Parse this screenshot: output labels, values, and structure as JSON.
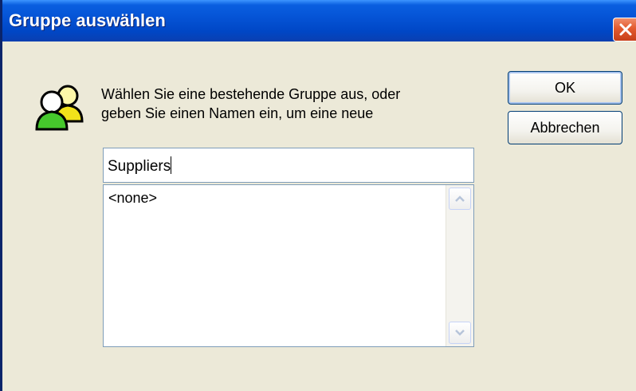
{
  "window": {
    "title": "Gruppe auswählen",
    "close_icon": "close-icon"
  },
  "dialog": {
    "icon": "user-group-icon",
    "instruction_line1": "Wählen Sie eine bestehende Gruppe aus, oder",
    "instruction_line2": "geben Sie einen Namen ein, um eine neue"
  },
  "buttons": {
    "ok_label": "OK",
    "cancel_label": "Abbrechen"
  },
  "name_input": {
    "value": "Suppliers"
  },
  "group_list": {
    "items": [
      "<none>"
    ]
  },
  "colors": {
    "title_bar": "#0554d6",
    "close_button": "#e35a2e",
    "dialog_background": "#ece9d8",
    "input_border": "#7f9db9"
  }
}
